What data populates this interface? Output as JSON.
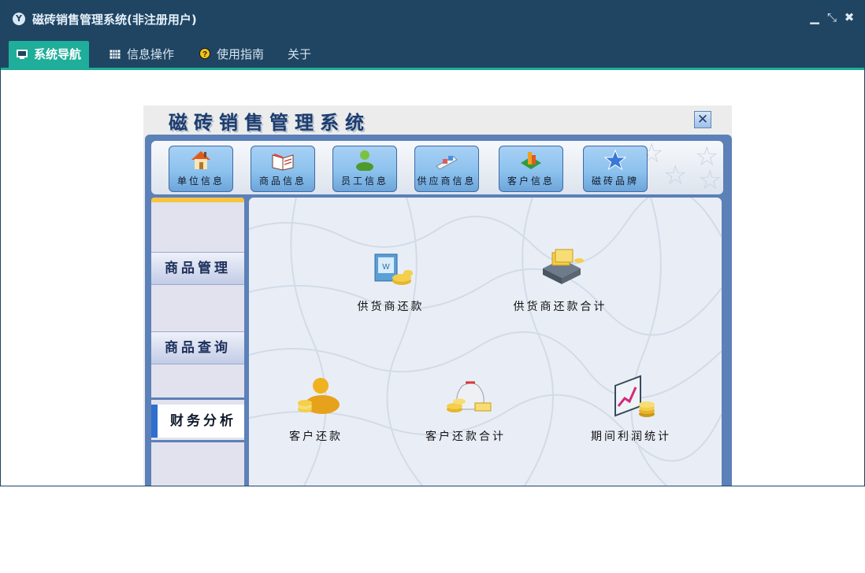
{
  "window": {
    "title": "磁砖销售管理系统(非注册用户)",
    "logo_letter": "Y",
    "controls": {
      "minimize": "▁",
      "restore": "⤡",
      "close": "✖"
    }
  },
  "menubar": {
    "items": [
      {
        "label": "系统导航",
        "icon": "monitor-icon",
        "active": true
      },
      {
        "label": "信息操作",
        "icon": "grid-icon",
        "active": false
      },
      {
        "label": "使用指南",
        "icon": "help-icon",
        "active": false
      },
      {
        "label": "关于",
        "active": false
      }
    ]
  },
  "app": {
    "title": "磁砖销售管理系统",
    "close_glyph": "✕",
    "toolbar": [
      {
        "label": "单位信息",
        "icon": "house-icon"
      },
      {
        "label": "商品信息",
        "icon": "book-icon"
      },
      {
        "label": "员工信息",
        "icon": "person-icon"
      },
      {
        "label": "供应商信息",
        "icon": "shipping-icon"
      },
      {
        "label": "客户信息",
        "icon": "customer-icon"
      },
      {
        "label": "磁砖品牌",
        "icon": "star-icon"
      }
    ],
    "sidebar": [
      {
        "label": "商品管理",
        "active": false
      },
      {
        "label": "商品查询",
        "active": false
      },
      {
        "label": "财务分析",
        "active": true
      }
    ],
    "features": [
      {
        "label": "供货商还款",
        "icon": "supplier-payment-icon"
      },
      {
        "label": "供货商还款合计",
        "icon": "money-box-icon"
      },
      {
        "label": "客户还款",
        "icon": "customer-coins-icon"
      },
      {
        "label": "客户还款合计",
        "icon": "money-bag-icon"
      },
      {
        "label": "期间利润统计",
        "icon": "profit-chart-icon"
      }
    ]
  },
  "colors": {
    "titlebar": "#1f4563",
    "accent": "#1fae9a",
    "app_frame": "#5c80b8",
    "toolbar_button": "#8cc2ee"
  }
}
